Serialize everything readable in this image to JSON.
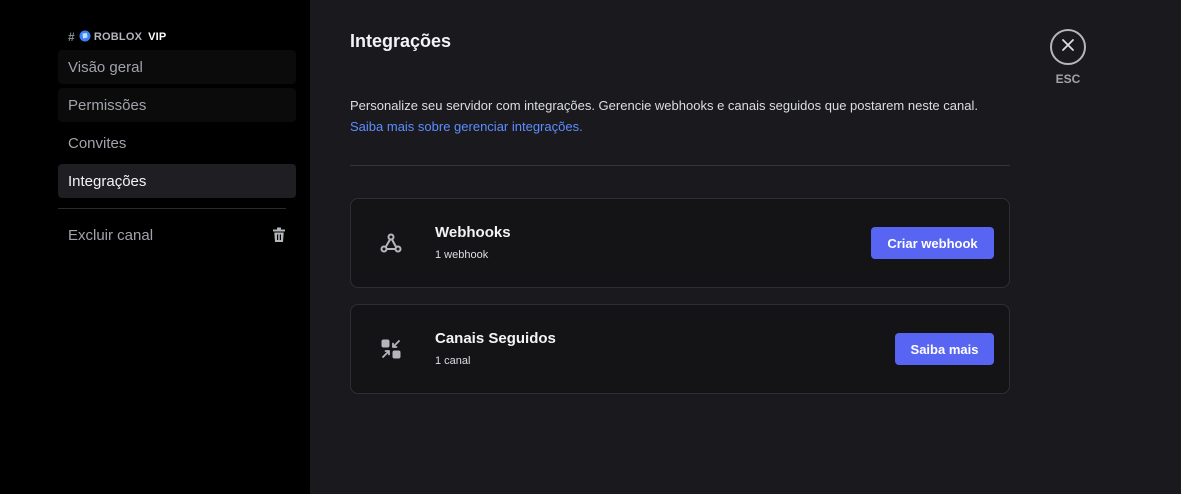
{
  "sidebar": {
    "channel_hash": "#",
    "channel_icon": "blue-crystal-icon",
    "channel_name": "ROBLOX",
    "channel_tag": "VIP",
    "items": [
      {
        "label": "Visão geral"
      },
      {
        "label": "Permissões"
      },
      {
        "label": "Convites"
      },
      {
        "label": "Integrações"
      }
    ],
    "delete_label": "Excluir canal"
  },
  "main": {
    "title": "Integrações",
    "description": "Personalize seu servidor com integrações. Gerencie webhooks e canais seguidos que postarem neste canal.",
    "learn_more_link": "Saiba mais sobre gerenciar integrações.",
    "cards": [
      {
        "icon": "webhook-icon",
        "title": "Webhooks",
        "subtitle": "1 webhook",
        "button": "Criar webhook"
      },
      {
        "icon": "follow-channel-icon",
        "title": "Canais Seguidos",
        "subtitle": "1 canal",
        "button": "Saiba mais"
      }
    ]
  },
  "close": {
    "label": "ESC"
  },
  "colors": {
    "accent": "#5865f2",
    "link": "#5c8dff",
    "background": "#1a1a1e",
    "sidebar": "#000000"
  }
}
